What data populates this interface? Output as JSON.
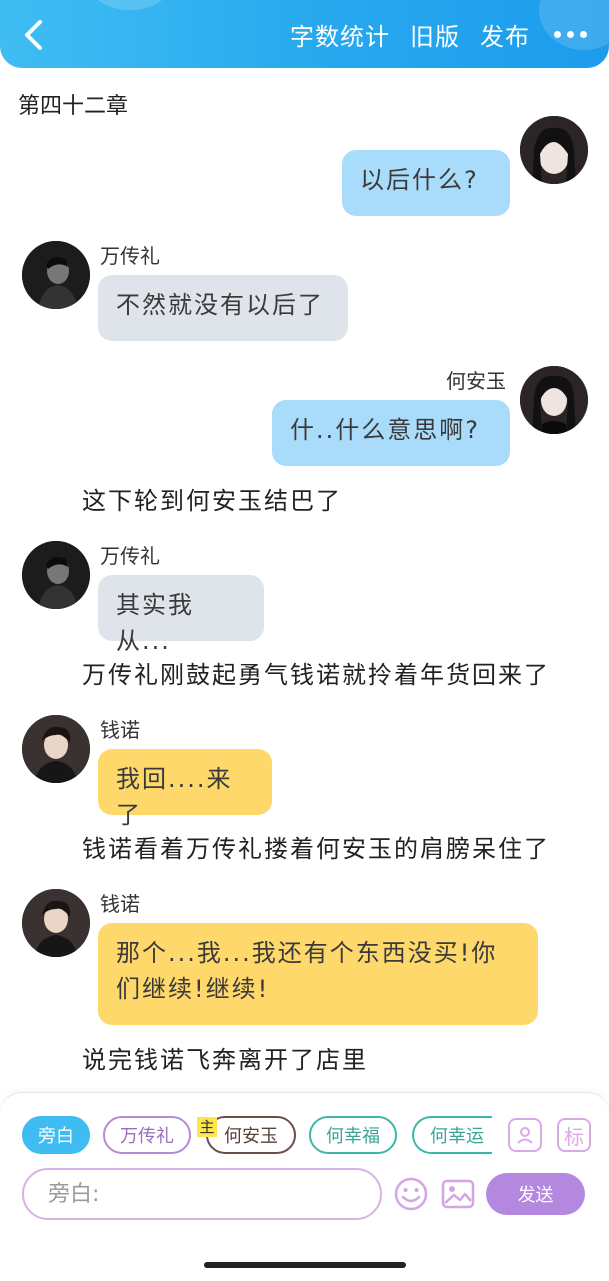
{
  "header": {
    "actions": [
      "字数统计",
      "旧版",
      "发布"
    ]
  },
  "chapter_title": "第四十二章",
  "messages": [
    {
      "speaker": "",
      "text": "以后什么?"
    },
    {
      "speaker": "万传礼",
      "text": "不然就没有以后了"
    },
    {
      "speaker": "何安玉",
      "text": "什..什么意思啊?"
    },
    {
      "narration": "这下轮到何安玉结巴了"
    },
    {
      "speaker": "万传礼",
      "text": "其实我从..."
    },
    {
      "narration": "万传礼刚鼓起勇气钱诺就拎着年货回来了"
    },
    {
      "speaker": "钱诺",
      "text": "我回....来了"
    },
    {
      "narration": "钱诺看着万传礼搂着何安玉的肩膀呆住了"
    },
    {
      "speaker": "钱诺",
      "text": "那个...我...我还有个东西没买!你们继续!继续!"
    },
    {
      "narration": "说完钱诺飞奔离开了店里"
    }
  ],
  "roles": [
    "旁白",
    "万传礼",
    "何安玉",
    "何幸福",
    "何幸运"
  ],
  "lead_badge": "主",
  "tools": {
    "role_icon": "person-card",
    "tag_label": "标"
  },
  "input": {
    "placeholder": "旁白:",
    "value": ""
  },
  "send_label": "发送",
  "colors": {
    "header": "#27a8ee",
    "bubble_right": "#a9dcfb",
    "bubble_gray": "#dfe3ea",
    "bubble_yellow": "#ffd86b",
    "send": "#b588e0"
  }
}
